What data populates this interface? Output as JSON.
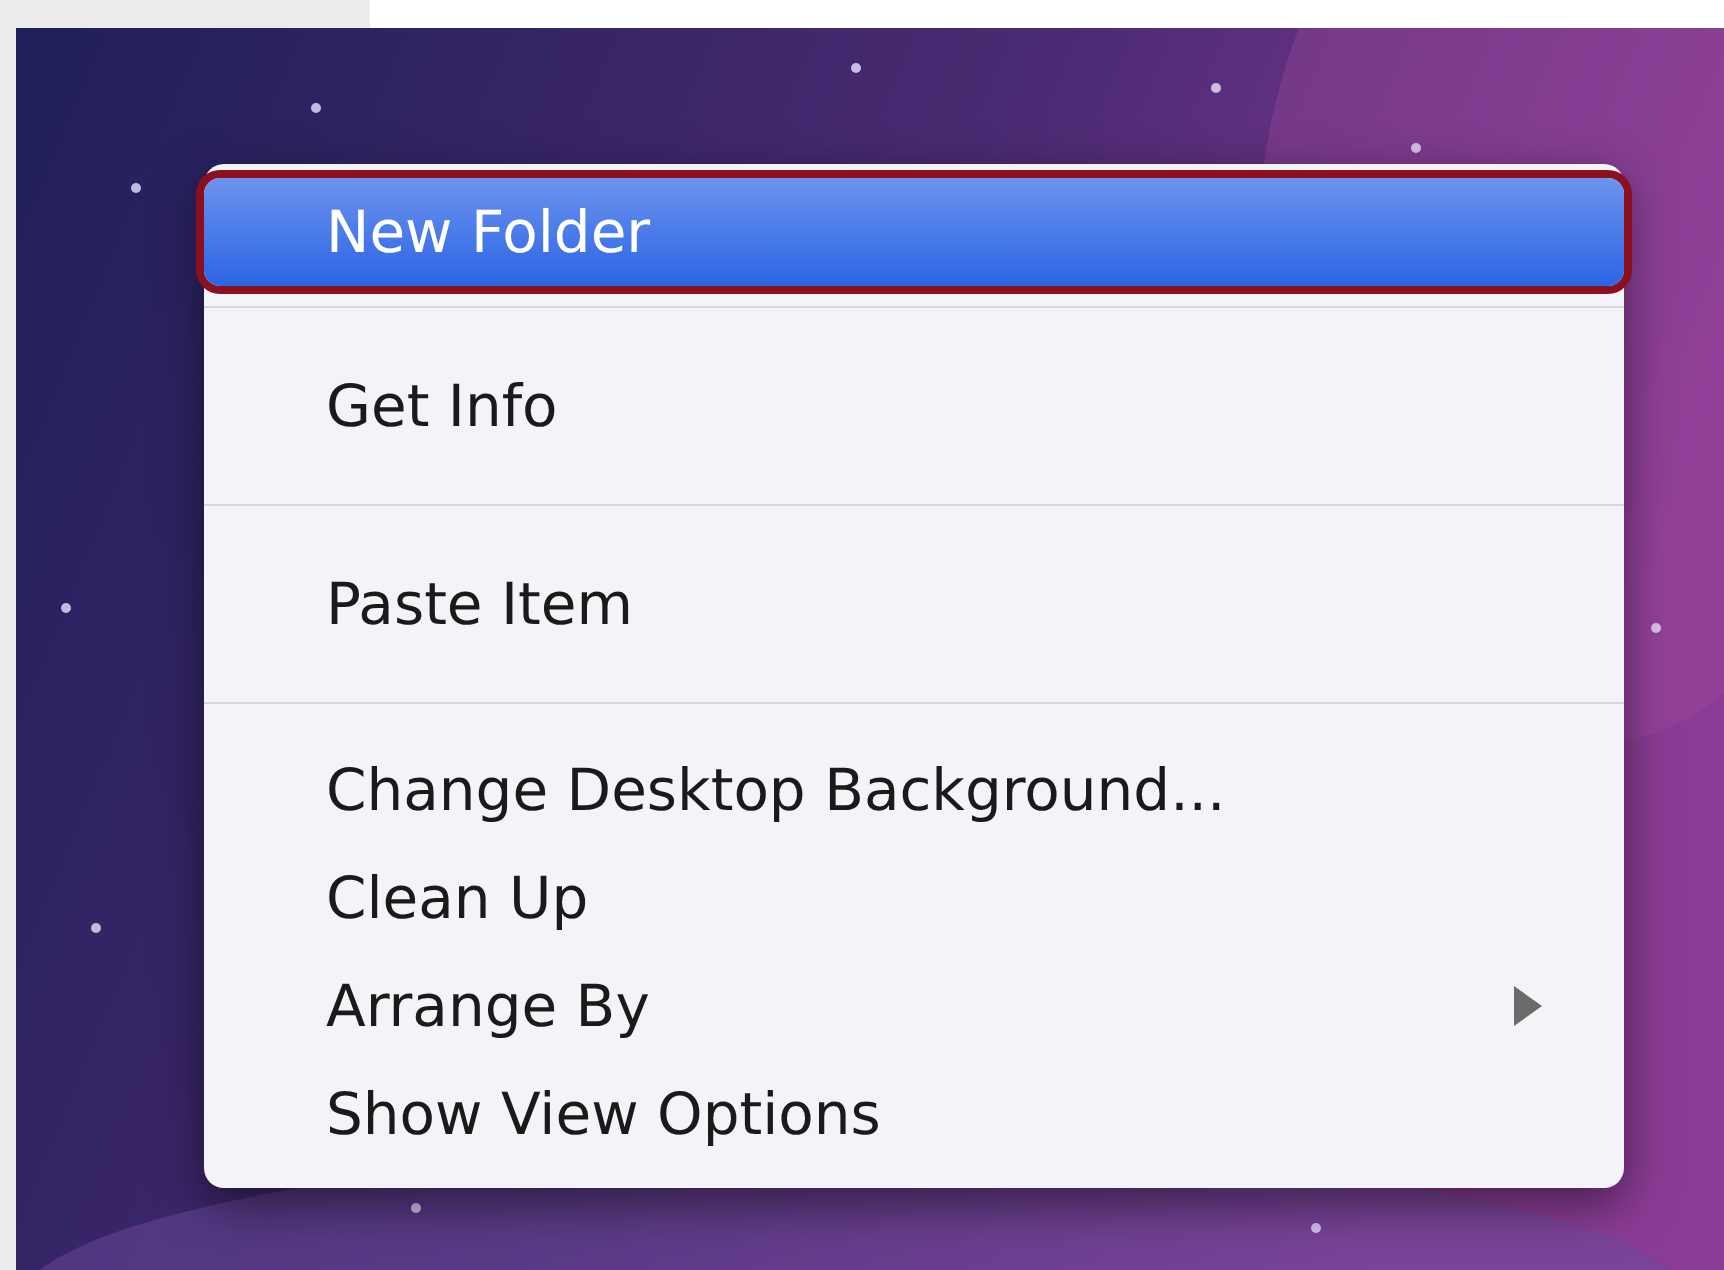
{
  "context_menu": {
    "groups": [
      {
        "items": [
          {
            "label": "New Folder",
            "selected": true,
            "outlined": true,
            "submenu": false
          }
        ]
      },
      {
        "items": [
          {
            "label": "Get Info",
            "selected": false,
            "outlined": false,
            "submenu": false
          }
        ]
      },
      {
        "items": [
          {
            "label": "Paste Item",
            "selected": false,
            "outlined": false,
            "submenu": false
          }
        ]
      },
      {
        "items": [
          {
            "label": "Change Desktop Background...",
            "selected": false,
            "outlined": false,
            "submenu": false
          },
          {
            "label": "Clean Up",
            "selected": false,
            "outlined": false,
            "submenu": false
          },
          {
            "label": "Arrange By",
            "selected": false,
            "outlined": false,
            "submenu": true
          },
          {
            "label": "Show View Options",
            "selected": false,
            "outlined": false,
            "submenu": false
          }
        ]
      }
    ]
  }
}
